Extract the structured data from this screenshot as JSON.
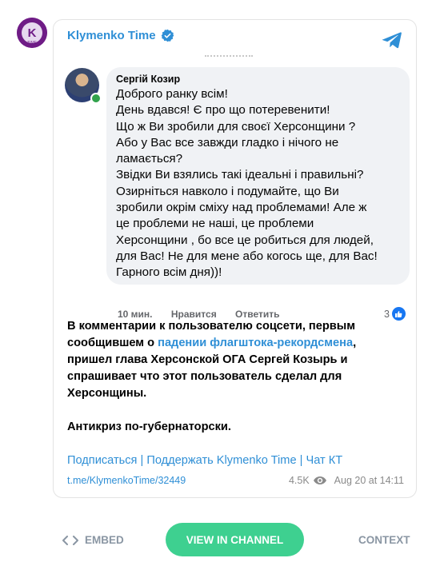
{
  "channel": {
    "name": "Klymenko Time",
    "avatar_text": "K",
    "avatar_sub": "TIME",
    "accent": "#2f8fd6"
  },
  "facebook_comment": {
    "author": "Сергій Козир",
    "lines": [
      "Доброго ранку всім!",
      "День вдався! Є про що потеревенити!",
      "Що ж Ви зробили для своєї Херсонщини ?",
      "Або у Вас все завжди гладко і нічого не",
      "ламається?",
      "Звідки Ви взялись такі ідеальні і правильні?",
      "Озирніться навколо і подумайте, що Ви",
      "зробили окрім сміху над проблемами! Але ж",
      "це проблеми не наші, це проблеми",
      "Херсонщини , бо все це робиться для людей,",
      "для Вас! Не для мене або когось ще, для Вас!",
      "Гарного всім дня))!"
    ],
    "time": "10 мин.",
    "like_label": "Нравится",
    "reply_label": "Ответить",
    "like_count": "3"
  },
  "message": {
    "p1_a": "В комментарии к пользователю соцсети, первым",
    "p1_b": "сообщившем о ",
    "p1_link": "падении флагштока-рекордсмена",
    "p1_c": ",",
    "p1_d": "пришел глава Херсонской ОГА Сергей Козырь и",
    "p1_e": "спрашивает что этот пользователь сделал для",
    "p1_f": "Херсонщины.",
    "p2": "Антикриз по-губернаторски."
  },
  "links": {
    "subscribe": "Подписаться",
    "support": "Поддержать Klymenko Time",
    "chat": "Чат КТ",
    "sep": "|"
  },
  "meta": {
    "post_link": "t.me/KlymenkoTime/32449",
    "views": "4.5K",
    "date": "Aug 20 at 14:11"
  },
  "footer": {
    "embed": "EMBED",
    "view": "VIEW IN CHANNEL",
    "context": "CONTEXT",
    "button_color": "#3ed090"
  }
}
